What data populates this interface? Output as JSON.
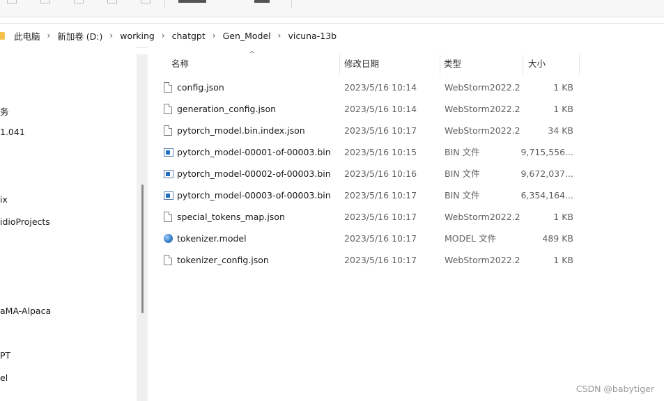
{
  "breadcrumb": [
    "此电脑",
    "新加卷 (D:)",
    "working",
    "chatgpt",
    "Gen_Model",
    "vicuna-13b"
  ],
  "nav_pane": {
    "items": [
      "务",
      "1.041",
      "ix",
      "idioProjects",
      "aMA-Alpaca",
      "PT",
      "el"
    ]
  },
  "columns": {
    "name": "名称",
    "date": "修改日期",
    "type": "类型",
    "size": "大小"
  },
  "files": [
    {
      "name": "config.json",
      "date": "2023/5/16 10:14",
      "type": "WebStorm2022.2",
      "size": "1 KB",
      "icon": "json-file-icon"
    },
    {
      "name": "generation_config.json",
      "date": "2023/5/16 10:14",
      "type": "WebStorm2022.2",
      "size": "1 KB",
      "icon": "json-file-icon"
    },
    {
      "name": "pytorch_model.bin.index.json",
      "date": "2023/5/16 10:17",
      "type": "WebStorm2022.2",
      "size": "34 KB",
      "icon": "json-file-icon"
    },
    {
      "name": "pytorch_model-00001-of-00003.bin",
      "date": "2023/5/16 10:15",
      "type": "BIN 文件",
      "size": "9,715,556...",
      "icon": "bin-file-icon"
    },
    {
      "name": "pytorch_model-00002-of-00003.bin",
      "date": "2023/5/16 10:16",
      "type": "BIN 文件",
      "size": "9,672,037...",
      "icon": "bin-file-icon"
    },
    {
      "name": "pytorch_model-00003-of-00003.bin",
      "date": "2023/5/16 10:17",
      "type": "BIN 文件",
      "size": "6,354,164...",
      "icon": "bin-file-icon"
    },
    {
      "name": "special_tokens_map.json",
      "date": "2023/5/16 10:17",
      "type": "WebStorm2022.2",
      "size": "1 KB",
      "icon": "json-file-icon"
    },
    {
      "name": "tokenizer.model",
      "date": "2023/5/16 10:17",
      "type": "MODEL 文件",
      "size": "489 KB",
      "icon": "model-file-icon"
    },
    {
      "name": "tokenizer_config.json",
      "date": "2023/5/16 10:17",
      "type": "WebStorm2022.2",
      "size": "1 KB",
      "icon": "json-file-icon"
    }
  ],
  "watermark": "CSDN @babytiger"
}
